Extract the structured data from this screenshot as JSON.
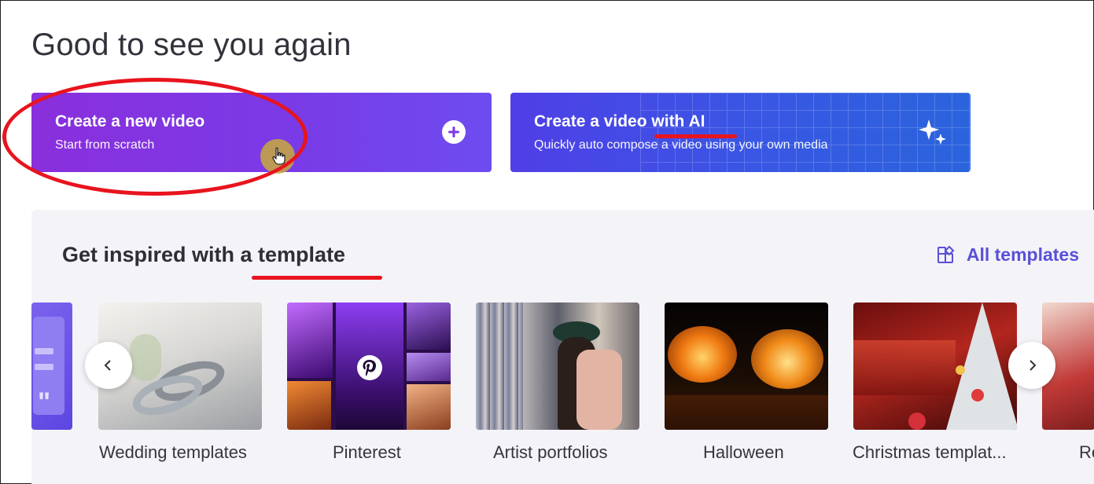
{
  "header": {
    "greeting": "Good to see you again"
  },
  "cards": {
    "new_video": {
      "title": "Create a new video",
      "subtitle": "Start from scratch",
      "icon": "plus-circle-icon"
    },
    "ai_video": {
      "title": "Create a video with AI",
      "subtitle": "Quickly auto compose a video using your own media",
      "icon": "sparkle-icon"
    }
  },
  "templates": {
    "section_title": "Get inspired with a template",
    "all_templates_label": "All templates",
    "items": [
      {
        "label": "Wedding templates"
      },
      {
        "label": "Pinterest"
      },
      {
        "label": "Artist portfolios"
      },
      {
        "label": "Halloween"
      },
      {
        "label": "Christmas templat..."
      },
      {
        "label": "Re"
      }
    ]
  },
  "colors": {
    "accent": "#5a50d6",
    "annotation": "#e8141e"
  }
}
